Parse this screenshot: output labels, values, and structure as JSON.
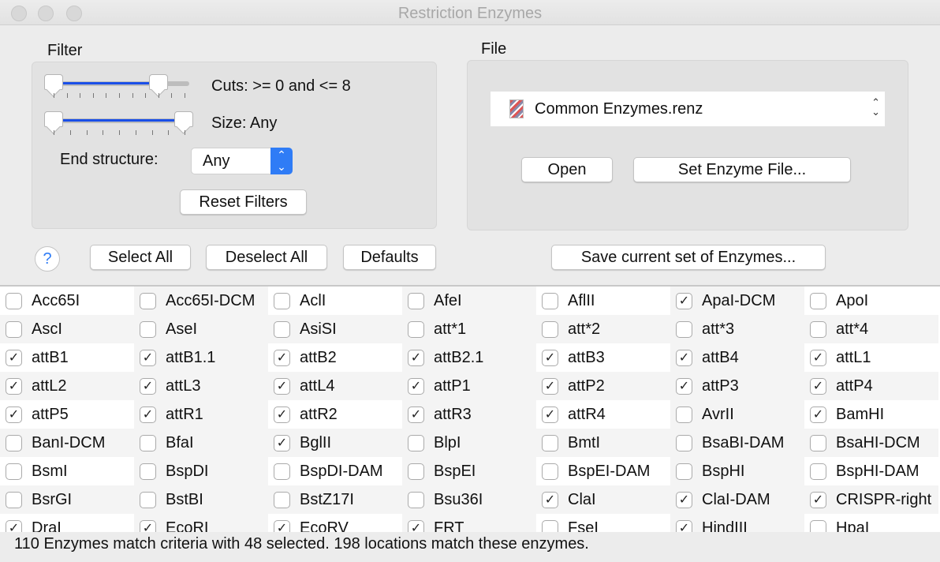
{
  "window": {
    "title": "Restriction Enzymes"
  },
  "filter": {
    "label": "Filter",
    "cuts_label": "Cuts: >= 0 and <= 8",
    "cuts_range": [
      0,
      8
    ],
    "cuts_max": 10,
    "size_label": "Size: Any",
    "end_structure_label": "End structure:",
    "end_structure_value": "Any",
    "reset_label": "Reset Filters"
  },
  "file": {
    "label": "File",
    "selected": "Common Enzymes.renz",
    "open_label": "Open",
    "set_file_label": "Set Enzyme File..."
  },
  "toolbar": {
    "help": "?",
    "select_all": "Select All",
    "deselect_all": "Deselect All",
    "defaults": "Defaults",
    "save_set": "Save current set of Enzymes..."
  },
  "enzymes": [
    {
      "name": "Acc65I",
      "checked": false
    },
    {
      "name": "Acc65I-DCM",
      "checked": false
    },
    {
      "name": "AclI",
      "checked": false
    },
    {
      "name": "AfeI",
      "checked": false
    },
    {
      "name": "AflII",
      "checked": false
    },
    {
      "name": "ApaI-DCM",
      "checked": true
    },
    {
      "name": "ApoI",
      "checked": false
    },
    {
      "name": "AscI",
      "checked": false
    },
    {
      "name": "AseI",
      "checked": false
    },
    {
      "name": "AsiSI",
      "checked": false
    },
    {
      "name": "att*1",
      "checked": false
    },
    {
      "name": "att*2",
      "checked": false
    },
    {
      "name": "att*3",
      "checked": false
    },
    {
      "name": "att*4",
      "checked": false
    },
    {
      "name": "attB1",
      "checked": true
    },
    {
      "name": "attB1.1",
      "checked": true
    },
    {
      "name": "attB2",
      "checked": true
    },
    {
      "name": "attB2.1",
      "checked": true
    },
    {
      "name": "attB3",
      "checked": true
    },
    {
      "name": "attB4",
      "checked": true
    },
    {
      "name": "attL1",
      "checked": true
    },
    {
      "name": "attL2",
      "checked": true
    },
    {
      "name": "attL3",
      "checked": true
    },
    {
      "name": "attL4",
      "checked": true
    },
    {
      "name": "attP1",
      "checked": true
    },
    {
      "name": "attP2",
      "checked": true
    },
    {
      "name": "attP3",
      "checked": true
    },
    {
      "name": "attP4",
      "checked": true
    },
    {
      "name": "attP5",
      "checked": true
    },
    {
      "name": "attR1",
      "checked": true
    },
    {
      "name": "attR2",
      "checked": true
    },
    {
      "name": "attR3",
      "checked": true
    },
    {
      "name": "attR4",
      "checked": true
    },
    {
      "name": "AvrII",
      "checked": false
    },
    {
      "name": "BamHI",
      "checked": true
    },
    {
      "name": "BanI-DCM",
      "checked": false
    },
    {
      "name": "BfaI",
      "checked": false
    },
    {
      "name": "BglII",
      "checked": true
    },
    {
      "name": "BlpI",
      "checked": false
    },
    {
      "name": "BmtI",
      "checked": false
    },
    {
      "name": "BsaBI-DAM",
      "checked": false
    },
    {
      "name": "BsaHI-DCM",
      "checked": false
    },
    {
      "name": "BsmI",
      "checked": false
    },
    {
      "name": "BspDI",
      "checked": false
    },
    {
      "name": "BspDI-DAM",
      "checked": false
    },
    {
      "name": "BspEI",
      "checked": false
    },
    {
      "name": "BspEI-DAM",
      "checked": false
    },
    {
      "name": "BspHI",
      "checked": false
    },
    {
      "name": "BspHI-DAM",
      "checked": false
    },
    {
      "name": "BsrGI",
      "checked": false
    },
    {
      "name": "BstBI",
      "checked": false
    },
    {
      "name": "BstZ17I",
      "checked": false
    },
    {
      "name": "Bsu36I",
      "checked": false
    },
    {
      "name": "ClaI",
      "checked": true
    },
    {
      "name": "ClaI-DAM",
      "checked": true
    },
    {
      "name": "CRISPR-right",
      "checked": true
    },
    {
      "name": "DraI",
      "checked": true
    },
    {
      "name": "EcoRI",
      "checked": true
    },
    {
      "name": "EcoRV",
      "checked": true
    },
    {
      "name": "FRT",
      "checked": true
    },
    {
      "name": "FseI",
      "checked": false
    },
    {
      "name": "HindIII",
      "checked": true
    },
    {
      "name": "HpaI",
      "checked": false
    }
  ],
  "status": "110 Enzymes match criteria with 48 selected. 198 locations match these enzymes."
}
